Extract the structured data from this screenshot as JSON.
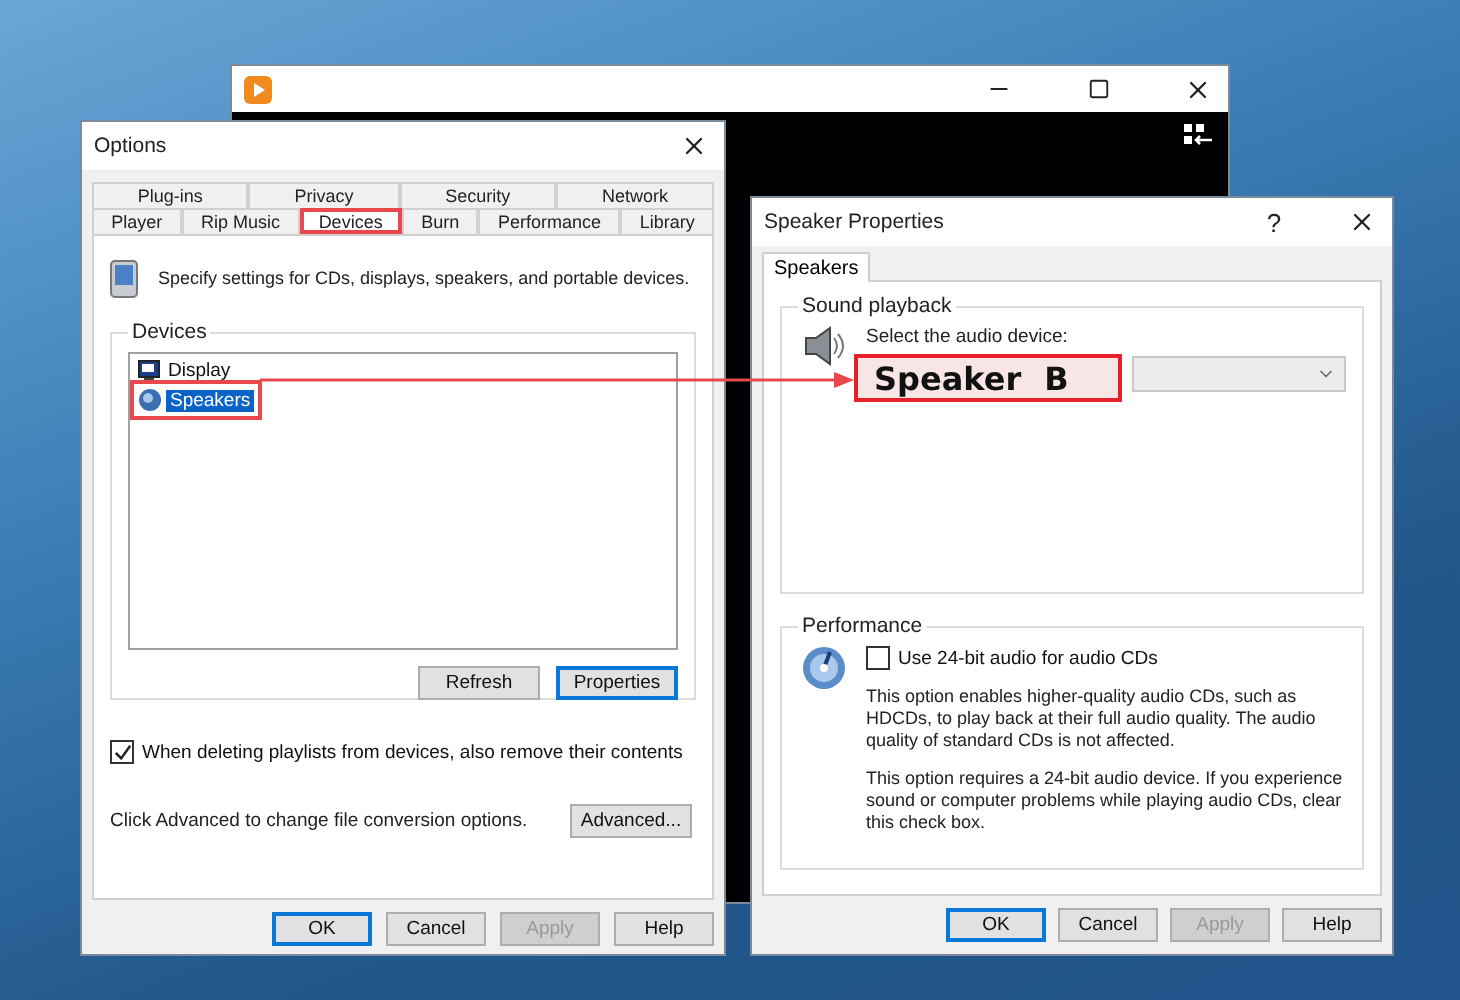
{
  "options_window": {
    "title": "Options",
    "tab_rows": [
      [
        {
          "label": "Plug-ins",
          "selected": false,
          "highlighted": false
        },
        {
          "label": "Privacy",
          "selected": false,
          "highlighted": false
        },
        {
          "label": "Security",
          "selected": false,
          "highlighted": false
        },
        {
          "label": "Network",
          "selected": false,
          "highlighted": false
        }
      ],
      [
        {
          "label": "Player",
          "selected": false,
          "highlighted": false
        },
        {
          "label": "Rip Music",
          "selected": false,
          "highlighted": false
        },
        {
          "label": "Devices",
          "selected": true,
          "highlighted": true
        },
        {
          "label": "Burn",
          "selected": false,
          "highlighted": false
        },
        {
          "label": "Performance",
          "selected": false,
          "highlighted": false
        },
        {
          "label": "Library",
          "selected": false,
          "highlighted": false
        }
      ]
    ],
    "intro": "Specify settings for CDs, displays, speakers, and portable devices.",
    "devices_group": {
      "title": "Devices",
      "items": [
        {
          "label": "Display",
          "kind": "display",
          "selected": false,
          "highlighted": false
        },
        {
          "label": "Speakers",
          "kind": "speaker",
          "selected": true,
          "highlighted": true
        }
      ],
      "buttons": [
        {
          "label": "Refresh",
          "default": false
        },
        {
          "label": "Properties",
          "default": true
        }
      ]
    },
    "remove_contents": {
      "label": "When deleting playlists from devices, also remove their contents",
      "checked": true
    },
    "advanced": {
      "text": "Click Advanced to change file conversion options.",
      "button": "Advanced..."
    },
    "buttons": [
      {
        "label": "OK",
        "default": true,
        "disabled": false
      },
      {
        "label": "Cancel",
        "default": false,
        "disabled": false
      },
      {
        "label": "Apply",
        "default": false,
        "disabled": true
      },
      {
        "label": "Help",
        "default": false,
        "disabled": false
      }
    ]
  },
  "speaker_properties": {
    "title": "Speaker Properties",
    "help": "?",
    "tabs": [
      {
        "label": "Speakers",
        "selected": true
      }
    ],
    "sound_playback": {
      "title": "Sound playback",
      "label": "Select the audio device:"
    },
    "performance": {
      "title": "Performance",
      "checkbox": {
        "label": "Use 24-bit audio for audio CDs",
        "checked": false
      },
      "paragraphs": [
        "This option enables higher-quality audio CDs, such as HDCDs, to play back at their full audio quality. The audio quality of standard CDs is not affected.",
        "This option requires a 24-bit audio device. If you experience sound or computer problems while playing audio CDs, clear this check box."
      ]
    },
    "buttons": [
      {
        "label": "OK",
        "default": true,
        "disabled": false
      },
      {
        "label": "Cancel",
        "default": false,
        "disabled": false
      },
      {
        "label": "Apply",
        "default": false,
        "disabled": true
      },
      {
        "label": "Help",
        "default": false,
        "disabled": false
      }
    ]
  },
  "callout": {
    "text": "Speaker B"
  }
}
